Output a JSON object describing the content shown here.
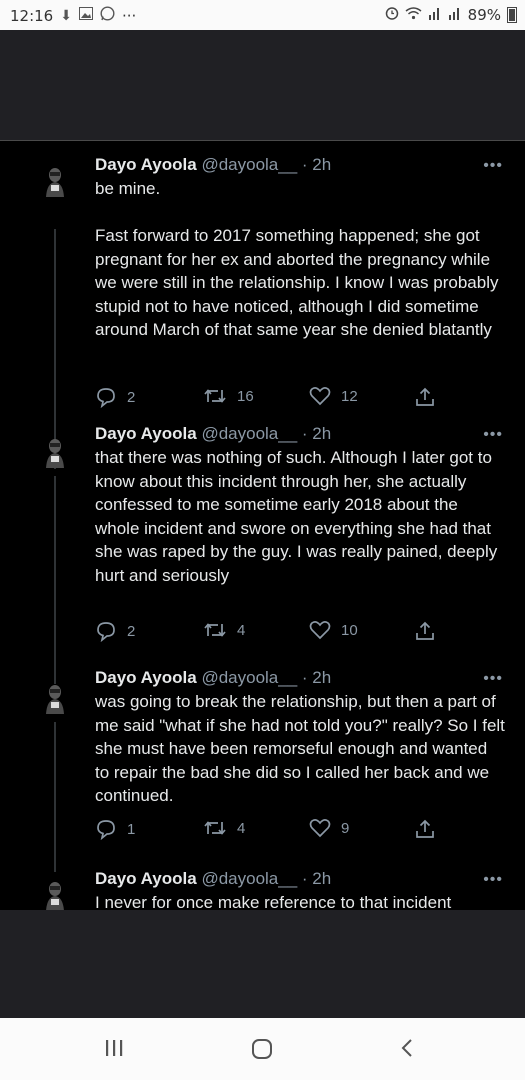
{
  "status_bar": {
    "time": "12:16",
    "more": "···",
    "battery": "89%",
    "icons": [
      "download-icon",
      "image-icon",
      "whatsapp-icon",
      "alarm-icon",
      "wifi-icon",
      "signal-icon",
      "signal-icon",
      "battery-icon"
    ]
  },
  "tweets": [
    {
      "name": "Dayo Ayoola",
      "handle": "@dayoola__",
      "time": "· 2h",
      "text": "be mine.\n\nFast forward to 2017 something happened; she got pregnant for her ex and aborted the pregnancy while we were still in the relationship. I know I was probably stupid not to have noticed, although I did sometime around March of that same year she denied blatantly",
      "replies": "2",
      "retweets": "16",
      "likes": "12"
    },
    {
      "name": "Dayo Ayoola",
      "handle": "@dayoola__",
      "time": "· 2h",
      "text": "that there was nothing of such. Although I later got to know about this incident through her, she actually confessed to me sometime early 2018 about the whole incident and swore on everything she had that she was raped by the guy. I was really pained, deeply hurt and seriously",
      "replies": "2",
      "retweets": "4",
      "likes": "10"
    },
    {
      "name": "Dayo Ayoola",
      "handle": "@dayoola__",
      "time": "· 2h",
      "text": "was going to break the relationship, but then a part of me said \"what if she had not told you?\" really? So I felt she must have been remorseful enough and wanted to repair the bad she did so I called her back and we continued.",
      "replies": "1",
      "retweets": "4",
      "likes": "9"
    },
    {
      "name": "Dayo Ayoola",
      "handle": "@dayoola__",
      "time": "· 2h",
      "text": "I never for once make reference to that incident"
    }
  ],
  "more_label": "•••",
  "colors": {
    "background": "#000000",
    "text": "#e7e9ea",
    "secondary": "#8b98a5",
    "chrome": "#202024"
  },
  "nav": [
    "recent-apps-icon",
    "home-icon",
    "back-icon"
  ]
}
